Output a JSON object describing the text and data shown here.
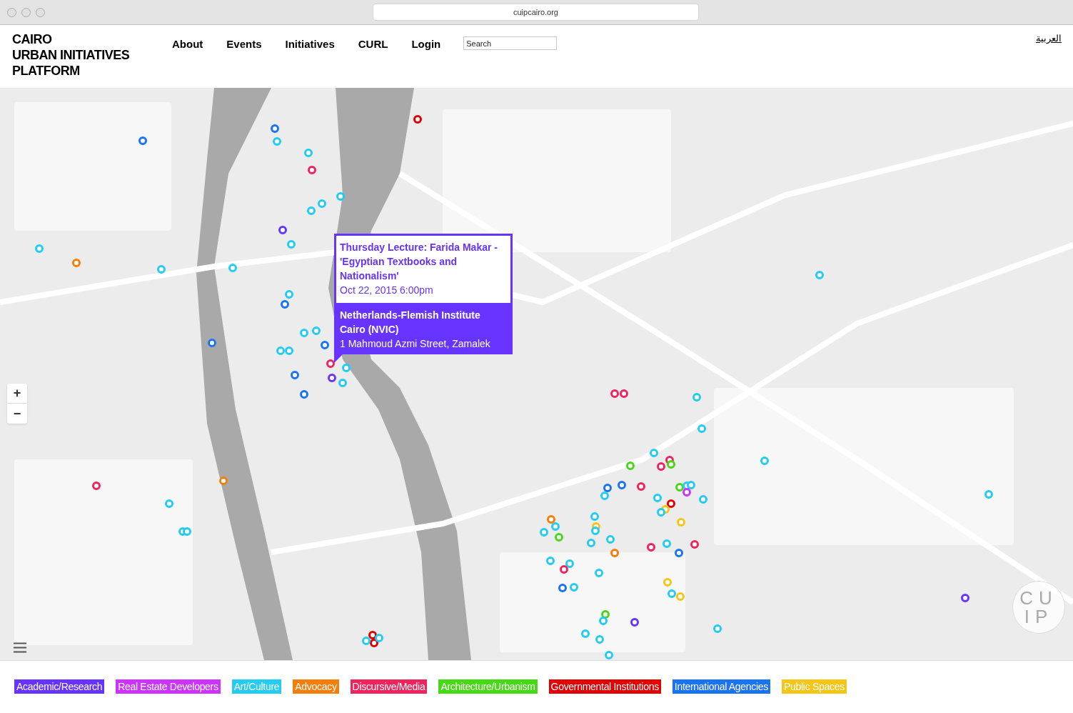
{
  "browser": {
    "url": "cuipcairo.org"
  },
  "site_title": [
    "CAIRO",
    "URBAN INITIATIVES",
    "PLATFORM"
  ],
  "nav": [
    {
      "label": "About"
    },
    {
      "label": "Events"
    },
    {
      "label": "Initiatives"
    },
    {
      "label": "CURL"
    },
    {
      "label": "Login"
    }
  ],
  "search": {
    "placeholder": "Search"
  },
  "language_link": "العربية",
  "map": {
    "zoom_in": "+",
    "zoom_out": "−",
    "logo": [
      "CU",
      "IP"
    ],
    "popup": {
      "title": "Thursday Lecture: Farida Makar - 'Egyptian Textbooks and Nationalism'",
      "date": "Oct 22, 2015 6:00pm",
      "venue": "Netherlands-Flemish Institute Cairo (NVIC)",
      "address": "1 Mahmoud Azmi Street, Zamalek",
      "color": "#6633ff"
    },
    "markers": [
      {
        "color": "#1a73f0"
      },
      {
        "color": "#1a73f0"
      },
      {
        "color": "#22ccf2"
      },
      {
        "color": "#22ccf2"
      },
      {
        "color": "#f0245c"
      },
      {
        "color": "#22ccf2"
      },
      {
        "color": "#22ccf2"
      },
      {
        "color": "#22ccf2"
      },
      {
        "color": "#e00000"
      },
      {
        "color": "#6633ff"
      },
      {
        "color": "#22ccf2"
      },
      {
        "color": "#22ccf2"
      },
      {
        "color": "#f57d0a"
      },
      {
        "color": "#22ccf2"
      },
      {
        "color": "#22ccf2"
      },
      {
        "color": "#22ccf2"
      },
      {
        "color": "#1a73f0"
      },
      {
        "color": "#22ccf2"
      },
      {
        "color": "#22ccf2"
      },
      {
        "color": "#1a73f0"
      },
      {
        "color": "#22ccf2"
      },
      {
        "color": "#22ccf2"
      },
      {
        "color": "#1a73f0"
      },
      {
        "color": "#f0245c"
      },
      {
        "color": "#22ccf2"
      },
      {
        "color": "#1a73f0"
      },
      {
        "color": "#6633ff"
      },
      {
        "color": "#22ccf2"
      },
      {
        "color": "#1a73f0"
      },
      {
        "color": "#f0245c"
      },
      {
        "color": "#f0245c"
      },
      {
        "color": "#22ccf2"
      },
      {
        "color": "#22ccf2"
      },
      {
        "color": "#22ccf2"
      },
      {
        "color": "#f0245c"
      },
      {
        "color": "#47d916"
      },
      {
        "color": "#f0245c"
      },
      {
        "color": "#47d916"
      },
      {
        "color": "#22ccf2"
      },
      {
        "color": "#f0245c"
      },
      {
        "color": "#22ccf2"
      },
      {
        "color": "#f0245c"
      },
      {
        "color": "#f57d0a"
      },
      {
        "color": "#22ccf2"
      },
      {
        "color": "#22ccf2"
      },
      {
        "color": "#22ccf2"
      },
      {
        "color": "#1a73f0"
      },
      {
        "color": "#22ccf2"
      },
      {
        "color": "#1a73f0"
      },
      {
        "color": "#47d916"
      },
      {
        "color": "#22ccf2"
      },
      {
        "color": "#22ccf2"
      },
      {
        "color": "#cc33ff"
      },
      {
        "color": "#22ccf2"
      },
      {
        "color": "#e00000"
      },
      {
        "color": "#f5c518"
      },
      {
        "color": "#22ccf2"
      },
      {
        "color": "#22ccf2"
      },
      {
        "color": "#f57d0a"
      },
      {
        "color": "#22ccf2"
      },
      {
        "color": "#22ccf2"
      },
      {
        "color": "#47d916"
      },
      {
        "color": "#22ccf2"
      },
      {
        "color": "#f5c518"
      },
      {
        "color": "#22ccf2"
      },
      {
        "color": "#22ccf2"
      },
      {
        "color": "#f5c518"
      },
      {
        "color": "#22ccf2"
      },
      {
        "color": "#f0245c"
      },
      {
        "color": "#22ccf2"
      },
      {
        "color": "#1a73f0"
      },
      {
        "color": "#f0245c"
      },
      {
        "color": "#f57d0a"
      },
      {
        "color": "#22ccf2"
      },
      {
        "color": "#22ccf2"
      },
      {
        "color": "#f0245c"
      },
      {
        "color": "#22ccf2"
      },
      {
        "color": "#22ccf2"
      },
      {
        "color": "#1a73f0"
      },
      {
        "color": "#f5c518"
      },
      {
        "color": "#22ccf2"
      },
      {
        "color": "#f5c518"
      },
      {
        "color": "#47d916"
      },
      {
        "color": "#22ccf2"
      },
      {
        "color": "#6633ff"
      },
      {
        "color": "#22ccf2"
      },
      {
        "color": "#22ccf2"
      },
      {
        "color": "#22ccf2"
      },
      {
        "color": "#22ccf2"
      },
      {
        "color": "#22ccf2"
      },
      {
        "color": "#6633ff"
      },
      {
        "color": "#e00000"
      },
      {
        "color": "#e00000"
      },
      {
        "color": "#22ccf2"
      },
      {
        "color": "#22ccf2"
      }
    ]
  },
  "legend": [
    {
      "label": "Academic/Research",
      "color": "#6633ff"
    },
    {
      "label": "Real Estate Developers",
      "color": "#cc33ff"
    },
    {
      "label": "Art/Culture",
      "color": "#22ccf2"
    },
    {
      "label": "Advocacy",
      "color": "#f57d0a"
    },
    {
      "label": "Discursive/Media",
      "color": "#f0245c"
    },
    {
      "label": "Architecture/Urbanism",
      "color": "#47d916"
    },
    {
      "label": "Governmental Institutions",
      "color": "#e00000"
    },
    {
      "label": "International Agencies",
      "color": "#1a73f0"
    },
    {
      "label": "Public Spaces",
      "color": "#f5c518"
    }
  ]
}
